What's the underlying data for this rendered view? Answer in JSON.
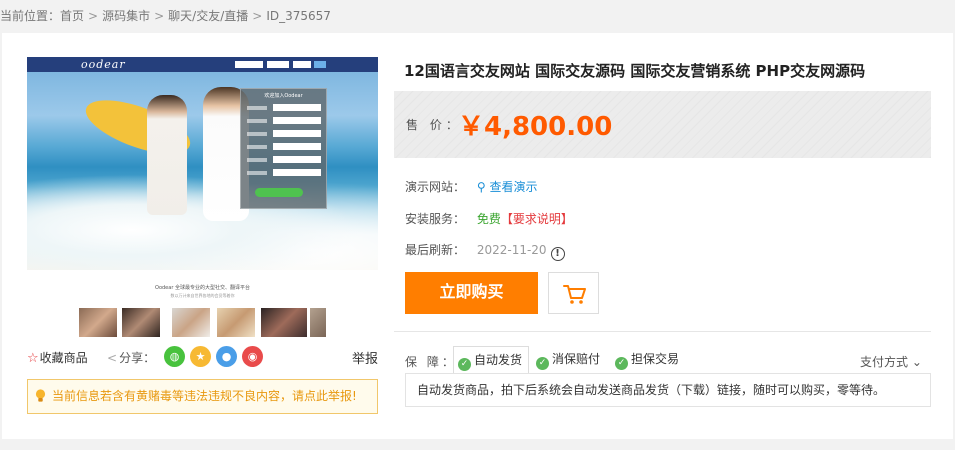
{
  "breadcrumb": {
    "prefix": "当前位置：",
    "items": [
      "首页",
      "源码集市",
      "聊天/交友/直播",
      "ID_375657"
    ],
    "separator": ">"
  },
  "product": {
    "title": "12国语言交友网站 国际交友源码 国际交友营销系统 PHP交友网源码",
    "price_label": "售 价：",
    "price": "￥4,800.00",
    "demo_label": "演示网站：",
    "demo_link": "查看演示",
    "install_label": "安装服务：",
    "install_value": "免费",
    "install_note": "【要求说明】",
    "refresh_label": "最后刷新：",
    "refresh_date": "2022-11-20",
    "buy_label": "立即购买"
  },
  "screenshot": {
    "logo": "oodear",
    "login_title": "欢迎加入Oodear",
    "tagline": "Oodear 全球最专业的大型社交、翻译平台",
    "subline": "数以万计来自世界各地的会员等着你"
  },
  "actions": {
    "favorite": "收藏商品",
    "share": "分享：",
    "report": "举报"
  },
  "warning": "当前信息若含有黄赌毒等违法违规不良内容，请点此举报!",
  "guarantee": {
    "label": "保 障：",
    "tabs": [
      "自动发货",
      "消保赔付",
      "担保交易"
    ],
    "payment": "支付方式",
    "description": "自动发货商品，拍下后系统会自动发送商品发货（下载）链接，随时可以购买，零等待。"
  },
  "colors": {
    "price": "#ff5a00",
    "buy_button": "#ff7e00",
    "link_blue": "#1b8fd7",
    "free_green": "#3aa52f",
    "note_red": "#e4393c",
    "warning_text": "#e8980f"
  },
  "icons": [
    "star-icon",
    "share-icon",
    "wechat-icon",
    "qzone-icon",
    "qq-icon",
    "weibo-icon",
    "search-icon",
    "info-icon",
    "cart-icon",
    "check-icon",
    "chevron-down-icon",
    "bulb-icon"
  ]
}
